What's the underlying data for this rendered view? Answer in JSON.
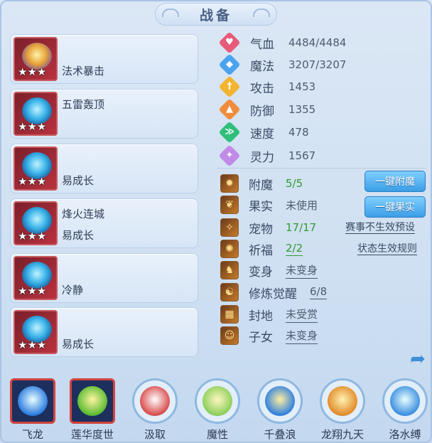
{
  "title": "战备",
  "cards": [
    {
      "line1": "",
      "line2": "法术暴击",
      "stars": "★★★",
      "core": "gold"
    },
    {
      "line1": "五雷轰顶",
      "line2": "",
      "stars": "★★★",
      "core": "blue"
    },
    {
      "line1": "",
      "line2": "易成长",
      "stars": "★★★",
      "core": "blue"
    },
    {
      "line1": "烽火连城",
      "line2": "易成长",
      "stars": "★★★",
      "core": "blue"
    },
    {
      "line1": "",
      "line2": "冷静",
      "stars": "★★★",
      "core": "blue"
    },
    {
      "line1": "",
      "line2": "易成长",
      "stars": "★★★",
      "core": "blue"
    }
  ],
  "stats": [
    {
      "label": "气血",
      "value": "4484/4484",
      "icon": "heart-icon",
      "glyph": "♥",
      "color": "#e85a7a"
    },
    {
      "label": "魔法",
      "value": "3207/3207",
      "icon": "mana-icon",
      "glyph": "◆",
      "color": "#4aa3ee"
    },
    {
      "label": "攻击",
      "value": "1453",
      "icon": "sword-icon",
      "glyph": "†",
      "color": "#f2b431"
    },
    {
      "label": "防御",
      "value": "1355",
      "icon": "armor-icon",
      "glyph": "▲",
      "color": "#f08c3c"
    },
    {
      "label": "速度",
      "value": "478",
      "icon": "speed-icon",
      "glyph": "≫",
      "color": "#2fbf7a"
    },
    {
      "label": "灵力",
      "value": "1567",
      "icon": "spirit-icon",
      "glyph": "✦",
      "color": "#c08be8"
    }
  ],
  "features": [
    {
      "label": "附魔",
      "value": "5/5",
      "style": "green",
      "icon": "enchant-icon",
      "glyph": "✹"
    },
    {
      "label": "果实",
      "value": "未使用",
      "style": "plain",
      "icon": "fruit-icon",
      "glyph": "❦"
    },
    {
      "label": "宠物",
      "value": "17/17",
      "style": "green",
      "icon": "pet-icon",
      "glyph": "✧"
    },
    {
      "label": "祈福",
      "value": "2/2",
      "style": "gu",
      "icon": "blessing-icon",
      "glyph": "✺"
    },
    {
      "label": "变身",
      "value": "未变身",
      "style": "u",
      "icon": "transform-icon",
      "glyph": "♞"
    },
    {
      "label": "修炼觉醒",
      "value": "6/8",
      "style": "u",
      "icon": "cultivation-icon",
      "glyph": "☯"
    },
    {
      "label": "封地",
      "value": "未受赏",
      "style": "u",
      "icon": "fief-icon",
      "glyph": "▦"
    },
    {
      "label": "子女",
      "value": "未变身",
      "style": "u",
      "icon": "child-icon",
      "glyph": "☺"
    }
  ],
  "buttons": {
    "enchant_all": "一键附魔",
    "fruit_all": "一键果实"
  },
  "links": {
    "preset": "赛事不生效预设",
    "rules": "状态生效规则"
  },
  "skills": [
    {
      "label": "飞龙",
      "shape": "square",
      "c1": "#eaffff",
      "c2": "#2a7be0"
    },
    {
      "label": "莲华度世",
      "shape": "square",
      "c1": "#fff4a0",
      "c2": "#5abb32"
    },
    {
      "label": "汲取",
      "shape": "round",
      "c1": "#ffffff",
      "c2": "#d94a4a"
    },
    {
      "label": "魔性",
      "shape": "round",
      "c1": "#fff6c0",
      "c2": "#8ccf5a"
    },
    {
      "label": "千叠浪",
      "shape": "round",
      "c1": "#fff0a0",
      "c2": "#2f7fe0"
    },
    {
      "label": "龙翔九天",
      "shape": "round",
      "c1": "#fff3b0",
      "c2": "#e28a2a"
    },
    {
      "label": "洛水缚",
      "shape": "round",
      "c1": "#eaffff",
      "c2": "#3a8fe0"
    }
  ]
}
